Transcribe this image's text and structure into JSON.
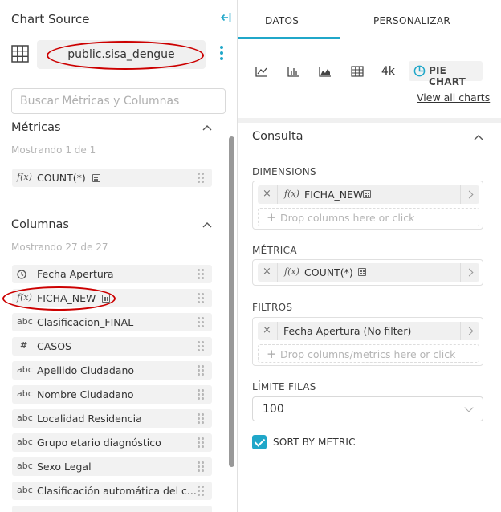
{
  "chart_source": {
    "title": "Chart Source",
    "dataset": "public.sisa_dengue"
  },
  "search": {
    "placeholder": "Buscar Métricas y Columnas"
  },
  "metrics": {
    "title": "Métricas",
    "showing": "Mostrando 1 de 1",
    "items": [
      {
        "type": "f(x)",
        "name": "COUNT(*)"
      }
    ]
  },
  "columns": {
    "title": "Columnas",
    "showing": "Mostrando 27 de 27",
    "items": [
      {
        "type": "clock",
        "name": "Fecha Apertura"
      },
      {
        "type": "f(x)",
        "name": "FICHA_NEW"
      },
      {
        "type": "abc",
        "name": "Clasificacion_FINAL"
      },
      {
        "type": "#",
        "name": "CASOS"
      },
      {
        "type": "abc",
        "name": "Apellido Ciudadano"
      },
      {
        "type": "abc",
        "name": "Nombre Ciudadano"
      },
      {
        "type": "abc",
        "name": "Localidad Residencia"
      },
      {
        "type": "abc",
        "name": "Grupo etario diagnóstico"
      },
      {
        "type": "abc",
        "name": "Sexo Legal"
      },
      {
        "type": "abc",
        "name": "Clasificación automática del c..."
      }
    ]
  },
  "tabs": {
    "datos": "DATOS",
    "personalizar": "PERSONALIZAR"
  },
  "viz": {
    "k4": "4k",
    "selected": "PIE CHART",
    "view_all": "View all charts"
  },
  "consulta": {
    "title": "Consulta",
    "dimensions_label": "DIMENSIONS",
    "dimension_item": "FICHA_NEW",
    "dimension_type": "f(x)",
    "dimensions_drop": "Drop columns here or click",
    "metric_label": "MÉTRICA",
    "metric_item": "COUNT(*)",
    "metric_type": "f(x)",
    "filters_label": "FILTROS",
    "filter_item": "Fecha Apertura (No filter)",
    "filters_drop": "Drop columns/metrics here or click",
    "limit_label": "LÍMITE FILAS",
    "limit_value": "100",
    "sort_label": "SORT BY METRIC"
  },
  "colors": {
    "accent": "#20a7c9",
    "highlight": "#cc0000"
  }
}
